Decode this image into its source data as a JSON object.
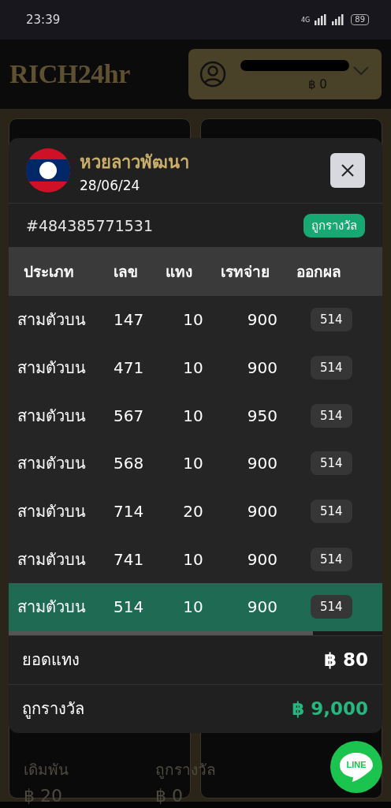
{
  "status_bar": {
    "time": "23:39",
    "network": "4G",
    "battery": "89"
  },
  "header": {
    "logo": "RICH24hr",
    "balance": "฿ 0"
  },
  "background_stats": [
    {
      "label": "เดิมพัน",
      "value": "฿ 20"
    },
    {
      "label": "ถูกรางวัล",
      "value": "฿ 0"
    }
  ],
  "modal": {
    "title": "หวยลาวพัฒนา",
    "date": "28/06/24",
    "ticket_id": "#484385771531",
    "status_badge": "ถูกรางวัล",
    "table": {
      "columns": [
        "ประเภท",
        "เลข",
        "แทง",
        "เรทจ่าย",
        "ออกผล"
      ],
      "rows": [
        {
          "type": "สามตัวบน",
          "number": "147",
          "bet": "10",
          "rate": "900",
          "result": "514",
          "selected": false
        },
        {
          "type": "สามตัวบน",
          "number": "471",
          "bet": "10",
          "rate": "900",
          "result": "514",
          "selected": false
        },
        {
          "type": "สามตัวบน",
          "number": "567",
          "bet": "10",
          "rate": "950",
          "result": "514",
          "selected": false
        },
        {
          "type": "สามตัวบน",
          "number": "568",
          "bet": "10",
          "rate": "900",
          "result": "514",
          "selected": false
        },
        {
          "type": "สามตัวบน",
          "number": "714",
          "bet": "20",
          "rate": "900",
          "result": "514",
          "selected": false
        },
        {
          "type": "สามตัวบน",
          "number": "741",
          "bet": "10",
          "rate": "900",
          "result": "514",
          "selected": false
        },
        {
          "type": "สามตัวบน",
          "number": "514",
          "bet": "10",
          "rate": "900",
          "result": "514",
          "selected": true
        }
      ]
    },
    "summary": [
      {
        "label": "ยอดแทง",
        "value": "฿ 80",
        "kind": "total"
      },
      {
        "label": "ถูกรางวัล",
        "value": "฿ 9,000",
        "kind": "win"
      }
    ]
  },
  "line_button": {
    "label": "LINE"
  }
}
